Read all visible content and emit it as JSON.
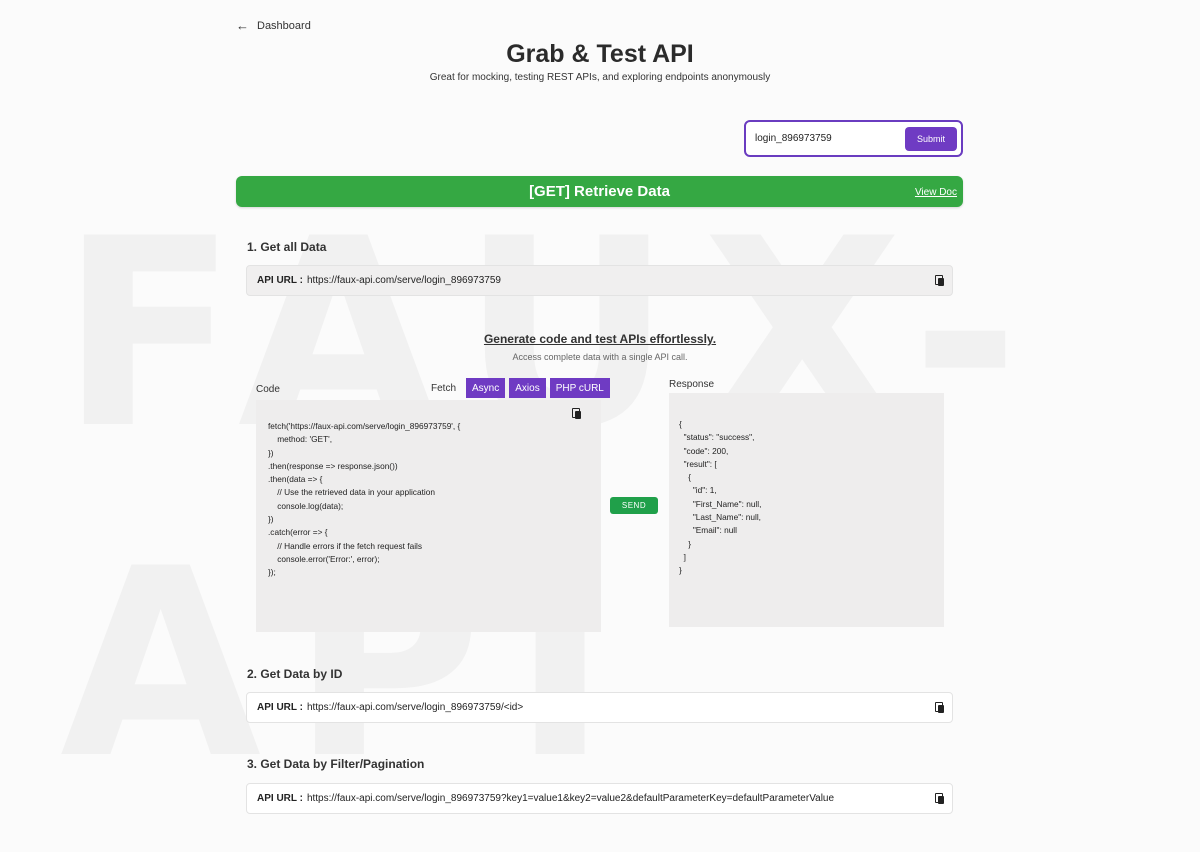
{
  "nav": {
    "back_label": "Dashboard"
  },
  "header": {
    "title": "Grab & Test API",
    "subtitle": "Great for mocking, testing REST APIs, and exploring endpoints anonymously"
  },
  "identifier": {
    "value": "login_896973759",
    "submit_label": "Submit"
  },
  "banner": {
    "title": "[GET] Retrieve Data",
    "view_doc_label": "View Doc",
    "color": "#35a843"
  },
  "sections": [
    {
      "title": "1. Get all Data",
      "url_label": "API URL :",
      "url": "https://faux-api.com/serve/login_896973759"
    },
    {
      "title": "2. Get Data by ID",
      "url_label": "API URL :",
      "url": "https://faux-api.com/serve/login_896973759/<id>"
    },
    {
      "title": "3. Get Data by Filter/Pagination",
      "url_label": "API URL :",
      "url": "https://faux-api.com/serve/login_896973759?key1=value1&key2=value2&defaultParameterKey=defaultParameterValue"
    }
  ],
  "generator": {
    "title": "Generate code and test APIs effortlessly.",
    "subtitle": "Access complete data with a single API call.",
    "code_label": "Code",
    "tabs": [
      "Fetch",
      "Async",
      "Axios",
      "PHP cURL"
    ],
    "active_tab": "Fetch",
    "code": "fetch('https://faux-api.com/serve/login_896973759', {\n    method: 'GET',\n})\n.then(response => response.json())\n.then(data => {\n    // Use the retrieved data in your application\n    console.log(data);\n})\n.catch(error => {\n    // Handle errors if the fetch request fails\n    console.error('Error:', error);\n});",
    "send_label": "SEND",
    "response_label": "Response",
    "response": "{\n  \"status\": \"success\",\n  \"code\": 200,\n  \"result\": [\n    {\n      \"id\": 1,\n      \"First_Name\": null,\n      \"Last_Name\": null,\n      \"Email\": null\n    }\n  ]\n}"
  },
  "colors": {
    "accent_purple": "#6f3bc3",
    "send_green": "#20a04a"
  },
  "icons": {
    "back": "arrow-left-icon",
    "copy": "copy-icon"
  }
}
